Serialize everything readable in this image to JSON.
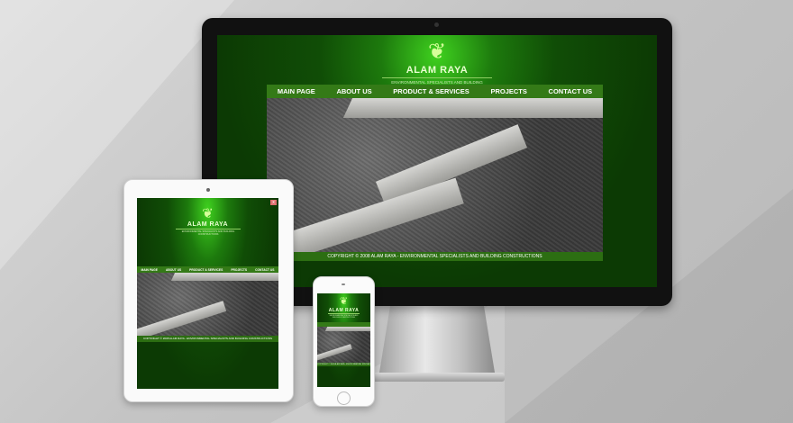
{
  "site": {
    "brand": "ALAM RAYA",
    "tagline": "ENVIRONMENTAL SPECIALISTS AND BUILDING CONSTRUCTIONS",
    "nav": [
      "MAIN PAGE",
      "ABOUT US",
      "PRODUCT & SERVICES",
      "PROJECTS",
      "CONTACT US"
    ],
    "footer": "COPYRIGHT © 2008 ALAM RAYA - ENVIRONMENTAL SPECIALISTS AND BUILDING CONSTRUCTIONS",
    "logo_icon": "leaf-logo-icon"
  },
  "tablet": {
    "close_label": "x"
  },
  "colors": {
    "nav_green": "#347a17",
    "background_green": "#0c3a04",
    "glow_green": "#3fd11f"
  }
}
